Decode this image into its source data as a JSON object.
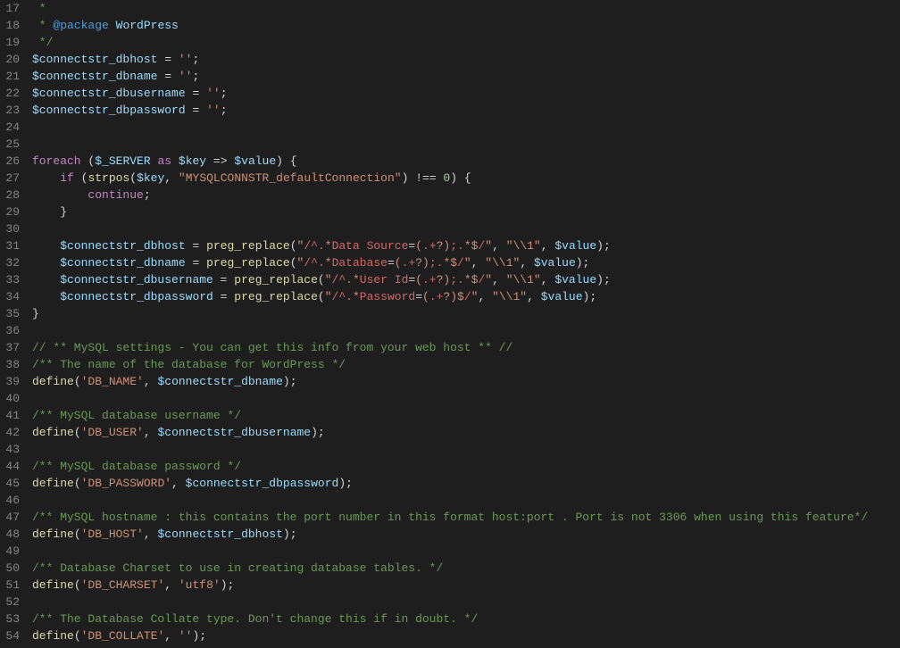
{
  "startLine": 17,
  "lines": [
    [
      [
        "comment",
        " *"
      ]
    ],
    [
      [
        "comment",
        " * "
      ],
      [
        "doctag",
        "@package"
      ],
      [
        "comment",
        " "
      ],
      [
        "docident",
        "WordPress"
      ]
    ],
    [
      [
        "comment",
        " */"
      ]
    ],
    [
      [
        "var",
        "$connectstr_dbhost"
      ],
      [
        "plain",
        " "
      ],
      [
        "op",
        "="
      ],
      [
        "plain",
        " "
      ],
      [
        "string",
        "''"
      ],
      [
        "punct",
        ";"
      ]
    ],
    [
      [
        "var",
        "$connectstr_dbname"
      ],
      [
        "plain",
        " "
      ],
      [
        "op",
        "="
      ],
      [
        "plain",
        " "
      ],
      [
        "string",
        "''"
      ],
      [
        "punct",
        ";"
      ]
    ],
    [
      [
        "var",
        "$connectstr_dbusername"
      ],
      [
        "plain",
        " "
      ],
      [
        "op",
        "="
      ],
      [
        "plain",
        " "
      ],
      [
        "string",
        "''"
      ],
      [
        "punct",
        ";"
      ]
    ],
    [
      [
        "var",
        "$connectstr_dbpassword"
      ],
      [
        "plain",
        " "
      ],
      [
        "op",
        "="
      ],
      [
        "plain",
        " "
      ],
      [
        "string",
        "''"
      ],
      [
        "punct",
        ";"
      ]
    ],
    [],
    [],
    [
      [
        "keyword",
        "foreach"
      ],
      [
        "plain",
        " "
      ],
      [
        "punct",
        "("
      ],
      [
        "var",
        "$_SERVER"
      ],
      [
        "plain",
        " "
      ],
      [
        "keyword",
        "as"
      ],
      [
        "plain",
        " "
      ],
      [
        "var",
        "$key"
      ],
      [
        "plain",
        " "
      ],
      [
        "op",
        "=>"
      ],
      [
        "plain",
        " "
      ],
      [
        "var",
        "$value"
      ],
      [
        "punct",
        ")"
      ],
      [
        "plain",
        " "
      ],
      [
        "punct",
        "{"
      ]
    ],
    [
      [
        "plain",
        "    "
      ],
      [
        "keyword",
        "if"
      ],
      [
        "plain",
        " "
      ],
      [
        "punct",
        "("
      ],
      [
        "func",
        "strpos"
      ],
      [
        "punct",
        "("
      ],
      [
        "var",
        "$key"
      ],
      [
        "punct",
        ","
      ],
      [
        "plain",
        " "
      ],
      [
        "string",
        "\"MYSQLCONNSTR_defaultConnection\""
      ],
      [
        "punct",
        ")"
      ],
      [
        "plain",
        " "
      ],
      [
        "op",
        "!=="
      ],
      [
        "plain",
        " "
      ],
      [
        "num",
        "0"
      ],
      [
        "punct",
        ")"
      ],
      [
        "plain",
        " "
      ],
      [
        "punct",
        "{"
      ]
    ],
    [
      [
        "plain",
        "        "
      ],
      [
        "keyword",
        "continue"
      ],
      [
        "punct",
        ";"
      ]
    ],
    [
      [
        "plain",
        "    "
      ],
      [
        "punct",
        "}"
      ]
    ],
    [],
    [
      [
        "plain",
        "    "
      ],
      [
        "var",
        "$connectstr_dbhost"
      ],
      [
        "plain",
        " "
      ],
      [
        "op",
        "="
      ],
      [
        "plain",
        " "
      ],
      [
        "func",
        "preg_replace"
      ],
      [
        "punct",
        "("
      ],
      [
        "string",
        "\""
      ],
      [
        "regex",
        "/^."
      ],
      [
        "regcls",
        "*"
      ],
      [
        "regex",
        "Data Source"
      ],
      [
        "op",
        "="
      ],
      [
        "regcls",
        "("
      ],
      [
        "regex",
        ".+"
      ],
      [
        "regcls",
        "?)"
      ],
      [
        "regex",
        ";."
      ],
      [
        "regcls",
        "*$"
      ],
      [
        "regex",
        "/"
      ],
      [
        "string",
        "\""
      ],
      [
        "punct",
        ","
      ],
      [
        "plain",
        " "
      ],
      [
        "string",
        "\"\\\\1\""
      ],
      [
        "punct",
        ","
      ],
      [
        "plain",
        " "
      ],
      [
        "var",
        "$value"
      ],
      [
        "punct",
        ");"
      ]
    ],
    [
      [
        "plain",
        "    "
      ],
      [
        "var",
        "$connectstr_dbname"
      ],
      [
        "plain",
        " "
      ],
      [
        "op",
        "="
      ],
      [
        "plain",
        " "
      ],
      [
        "func",
        "preg_replace"
      ],
      [
        "punct",
        "("
      ],
      [
        "string",
        "\""
      ],
      [
        "regex",
        "/^."
      ],
      [
        "regcls",
        "*"
      ],
      [
        "regex",
        "Database"
      ],
      [
        "op",
        "="
      ],
      [
        "regcls",
        "("
      ],
      [
        "regex",
        ".+"
      ],
      [
        "regcls",
        "?)"
      ],
      [
        "regex",
        ";."
      ],
      [
        "regcls",
        "*$"
      ],
      [
        "regex",
        "/"
      ],
      [
        "string",
        "\""
      ],
      [
        "punct",
        ","
      ],
      [
        "plain",
        " "
      ],
      [
        "string",
        "\"\\\\1\""
      ],
      [
        "punct",
        ","
      ],
      [
        "plain",
        " "
      ],
      [
        "var",
        "$value"
      ],
      [
        "punct",
        ");"
      ]
    ],
    [
      [
        "plain",
        "    "
      ],
      [
        "var",
        "$connectstr_dbusername"
      ],
      [
        "plain",
        " "
      ],
      [
        "op",
        "="
      ],
      [
        "plain",
        " "
      ],
      [
        "func",
        "preg_replace"
      ],
      [
        "punct",
        "("
      ],
      [
        "string",
        "\""
      ],
      [
        "regex",
        "/^."
      ],
      [
        "regcls",
        "*"
      ],
      [
        "regex",
        "User Id"
      ],
      [
        "op",
        "="
      ],
      [
        "regcls",
        "("
      ],
      [
        "regex",
        ".+"
      ],
      [
        "regcls",
        "?)"
      ],
      [
        "regex",
        ";."
      ],
      [
        "regcls",
        "*$"
      ],
      [
        "regex",
        "/"
      ],
      [
        "string",
        "\""
      ],
      [
        "punct",
        ","
      ],
      [
        "plain",
        " "
      ],
      [
        "string",
        "\"\\\\1\""
      ],
      [
        "punct",
        ","
      ],
      [
        "plain",
        " "
      ],
      [
        "var",
        "$value"
      ],
      [
        "punct",
        ");"
      ]
    ],
    [
      [
        "plain",
        "    "
      ],
      [
        "var",
        "$connectstr_dbpassword"
      ],
      [
        "plain",
        " "
      ],
      [
        "op",
        "="
      ],
      [
        "plain",
        " "
      ],
      [
        "func",
        "preg_replace"
      ],
      [
        "punct",
        "("
      ],
      [
        "string",
        "\""
      ],
      [
        "regex",
        "/^."
      ],
      [
        "regcls",
        "*"
      ],
      [
        "regex",
        "Password"
      ],
      [
        "op",
        "="
      ],
      [
        "regcls",
        "("
      ],
      [
        "regex",
        ".+"
      ],
      [
        "regcls",
        "?)$"
      ],
      [
        "regex",
        "/"
      ],
      [
        "string",
        "\""
      ],
      [
        "punct",
        ","
      ],
      [
        "plain",
        " "
      ],
      [
        "string",
        "\"\\\\1\""
      ],
      [
        "punct",
        ","
      ],
      [
        "plain",
        " "
      ],
      [
        "var",
        "$value"
      ],
      [
        "punct",
        ");"
      ]
    ],
    [
      [
        "punct",
        "}"
      ]
    ],
    [],
    [
      [
        "comment",
        "// ** MySQL settings - You can get this info from your web host ** //"
      ]
    ],
    [
      [
        "comment",
        "/** The name of the database for WordPress */"
      ]
    ],
    [
      [
        "func",
        "define"
      ],
      [
        "punct",
        "("
      ],
      [
        "string",
        "'DB_NAME'"
      ],
      [
        "punct",
        ","
      ],
      [
        "plain",
        " "
      ],
      [
        "var",
        "$connectstr_dbname"
      ],
      [
        "punct",
        ");"
      ]
    ],
    [],
    [
      [
        "comment",
        "/** MySQL database username */"
      ]
    ],
    [
      [
        "func",
        "define"
      ],
      [
        "punct",
        "("
      ],
      [
        "string",
        "'DB_USER'"
      ],
      [
        "punct",
        ","
      ],
      [
        "plain",
        " "
      ],
      [
        "var",
        "$connectstr_dbusername"
      ],
      [
        "punct",
        ");"
      ]
    ],
    [],
    [
      [
        "comment",
        "/** MySQL database password */"
      ]
    ],
    [
      [
        "func",
        "define"
      ],
      [
        "punct",
        "("
      ],
      [
        "string",
        "'DB_PASSWORD'"
      ],
      [
        "punct",
        ","
      ],
      [
        "plain",
        " "
      ],
      [
        "var",
        "$connectstr_dbpassword"
      ],
      [
        "punct",
        ");"
      ]
    ],
    [],
    [
      [
        "comment",
        "/** MySQL hostname : this contains the port number in this format host:port . Port is not 3306 when using this feature*/"
      ]
    ],
    [
      [
        "func",
        "define"
      ],
      [
        "punct",
        "("
      ],
      [
        "string",
        "'DB_HOST'"
      ],
      [
        "punct",
        ","
      ],
      [
        "plain",
        " "
      ],
      [
        "var",
        "$connectstr_dbhost"
      ],
      [
        "punct",
        ");"
      ]
    ],
    [],
    [
      [
        "comment",
        "/** Database Charset to use in creating database tables. */"
      ]
    ],
    [
      [
        "func",
        "define"
      ],
      [
        "punct",
        "("
      ],
      [
        "string",
        "'DB_CHARSET'"
      ],
      [
        "punct",
        ","
      ],
      [
        "plain",
        " "
      ],
      [
        "string",
        "'utf8'"
      ],
      [
        "punct",
        ");"
      ]
    ],
    [],
    [
      [
        "comment",
        "/** The Database Collate type. Don't change this if in doubt. */"
      ]
    ],
    [
      [
        "func",
        "define"
      ],
      [
        "punct",
        "("
      ],
      [
        "string",
        "'DB_COLLATE'"
      ],
      [
        "punct",
        ","
      ],
      [
        "plain",
        " "
      ],
      [
        "string",
        "''"
      ],
      [
        "punct",
        ");"
      ]
    ]
  ]
}
